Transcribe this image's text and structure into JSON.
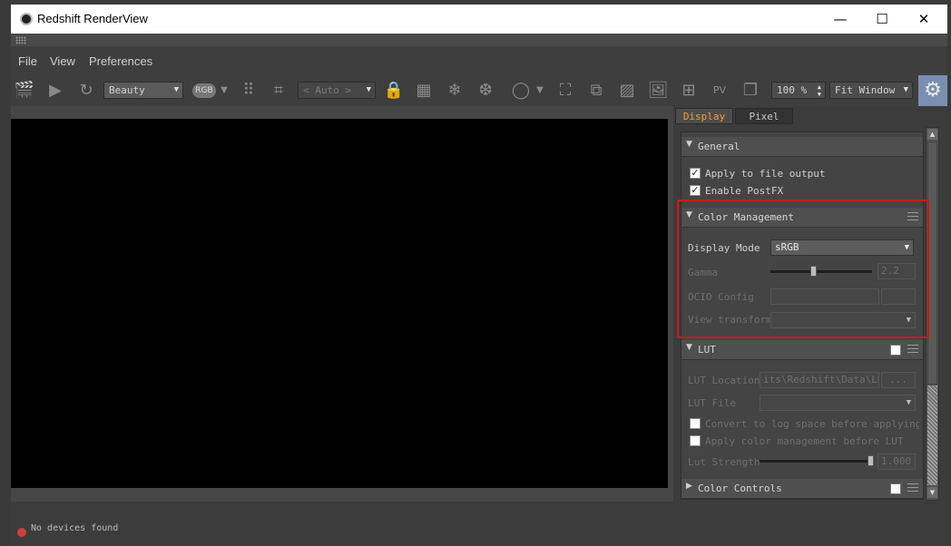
{
  "window": {
    "title": "Redshift RenderView"
  },
  "menu": {
    "file": "File",
    "view": "View",
    "preferences": "Preferences"
  },
  "toolbar": {
    "aov": "Beauty",
    "channel": "RGB",
    "camera": "< Auto >",
    "zoom": "100 %",
    "fit": "Fit Window"
  },
  "tabs": {
    "display": "Display",
    "pixel": "Pixel"
  },
  "general": {
    "header": "General",
    "apply_file_output": "Apply to file output",
    "enable_postfx": "Enable PostFX"
  },
  "color_management": {
    "header": "Color Management",
    "display_mode_label": "Display Mode",
    "display_mode_value": "sRGB",
    "gamma_label": "Gamma",
    "gamma_value": "2.2",
    "gamma_level": 0.42,
    "ocio_label": "OCIO Config",
    "view_transform_label": "View transform"
  },
  "lut": {
    "header": "LUT",
    "location_label": "LUT Location",
    "location_value": "its\\Redshift\\Data\\LUT",
    "browse": "...",
    "file_label": "LUT File",
    "log_space": "Convert to log space before applying LUT",
    "apply_cm": "Apply color management before LUT",
    "strength_label": "Lut Strength",
    "strength_value": "1.000",
    "strength_level": 1.0
  },
  "color_controls": {
    "header": "Color Controls"
  },
  "status": {
    "text": "No devices found"
  },
  "colors": {
    "highlight": "#d01818",
    "active_tab": "#f0a030",
    "gear_bg": "#7a8fb0"
  }
}
